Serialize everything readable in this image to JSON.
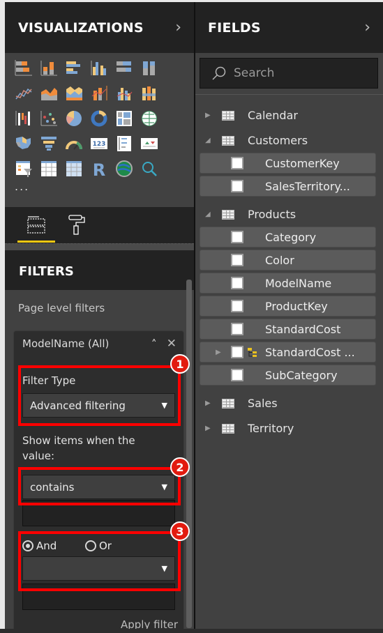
{
  "visualizations": {
    "title": "VISUALIZATIONS",
    "expand_icon": "chevron-right-icon",
    "icons": [
      "stacked-bar-chart-icon",
      "stacked-column-chart-icon",
      "clustered-bar-chart-icon",
      "clustered-column-chart-icon",
      "100-stacked-bar-chart-icon",
      "100-stacked-column-chart-icon",
      "line-chart-icon",
      "area-chart-icon",
      "stacked-area-chart-icon",
      "line-and-stacked-column-chart-icon",
      "line-and-clustered-column-chart-icon",
      "ribbon-chart-icon",
      "waterfall-chart-icon",
      "scatter-chart-icon",
      "pie-chart-icon",
      "donut-chart-icon",
      "treemap-icon",
      "map-icon",
      "filled-map-icon",
      "funnel-icon",
      "gauge-icon",
      "card-icon",
      "multi-row-card-icon",
      "kpi-icon",
      "slicer-icon",
      "table-icon",
      "matrix-icon",
      "r-script-visual-icon",
      "globe-map-icon",
      "search-visual-icon"
    ],
    "more_label": "...",
    "tabs": [
      {
        "name": "fields-tab",
        "icon": "fields-well-icon",
        "active": true
      },
      {
        "name": "format-tab",
        "icon": "paint-roller-icon",
        "active": false
      }
    ]
  },
  "filters": {
    "title": "FILTERS",
    "section_label": "Page level filters",
    "card": {
      "title": "ModelName (All)",
      "collapse_icon": "chevron-up-icon",
      "remove_icon": "close-icon",
      "filter_type_label": "Filter Type",
      "filter_type_value": "Advanced filtering",
      "show_items_label": "Show items when the value:",
      "condition1_value": "contains",
      "condition1_text": "",
      "logic_options": [
        {
          "label": "And",
          "selected": true
        },
        {
          "label": "Or",
          "selected": false
        }
      ],
      "condition2_value": "",
      "condition2_text": "",
      "apply_label": "Apply filter"
    },
    "callouts": [
      "1",
      "2",
      "3"
    ],
    "callout_color": "#e21b0f",
    "highlight_color": "#ff0000"
  },
  "fields": {
    "title": "FIELDS",
    "expand_icon": "chevron-right-icon",
    "search_placeholder": "Search",
    "tables": [
      {
        "name": "Calendar",
        "expanded": false,
        "fields": []
      },
      {
        "name": "Customers",
        "expanded": true,
        "fields": [
          {
            "name": "CustomerKey",
            "checked": false
          },
          {
            "name": "SalesTerritory...",
            "checked": false
          }
        ]
      },
      {
        "name": "Products",
        "expanded": true,
        "fields": [
          {
            "name": "Category",
            "checked": false
          },
          {
            "name": "Color",
            "checked": false
          },
          {
            "name": "ModelName",
            "checked": false
          },
          {
            "name": "ProductKey",
            "checked": false
          },
          {
            "name": "StandardCost",
            "checked": false
          },
          {
            "name": "StandardCost ...",
            "checked": false,
            "hierarchy": true
          },
          {
            "name": "SubCategory",
            "checked": false
          }
        ]
      },
      {
        "name": "Sales",
        "expanded": false,
        "fields": []
      },
      {
        "name": "Territory",
        "expanded": false,
        "fields": []
      }
    ]
  },
  "accent_color": "#f2c811"
}
